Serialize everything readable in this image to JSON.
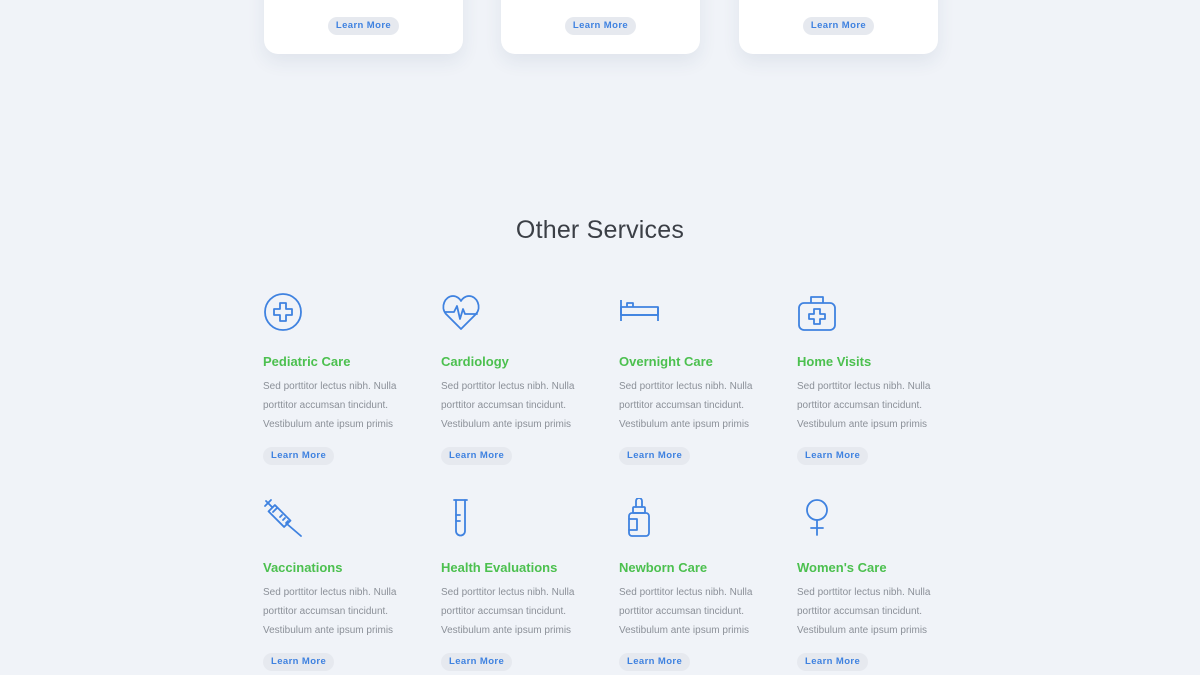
{
  "top_cards": [
    {
      "button": "Learn More"
    },
    {
      "button": "Learn More"
    },
    {
      "button": "Learn More"
    }
  ],
  "section": {
    "title": "Other Services"
  },
  "services": [
    {
      "name": "Pediatric Care",
      "desc": "Sed porttitor lectus nibh. Nulla porttitor accumsan tincidunt. Vestibulum ante ipsum primis",
      "button": "Learn More",
      "icon": "medical-cross-icon"
    },
    {
      "name": "Cardiology",
      "desc": "Sed porttitor lectus nibh. Nulla porttitor accumsan tincidunt. Vestibulum ante ipsum primis",
      "button": "Learn More",
      "icon": "heartbeat-icon"
    },
    {
      "name": "Overnight Care",
      "desc": "Sed porttitor lectus nibh. Nulla porttitor accumsan tincidunt. Vestibulum ante ipsum primis",
      "button": "Learn More",
      "icon": "bed-icon"
    },
    {
      "name": "Home Visits",
      "desc": "Sed porttitor lectus nibh. Nulla porttitor accumsan tincidunt. Vestibulum ante ipsum primis",
      "button": "Learn More",
      "icon": "medical-bag-icon"
    },
    {
      "name": "Vaccinations",
      "desc": "Sed porttitor lectus nibh. Nulla porttitor accumsan tincidunt. Vestibulum ante ipsum primis",
      "button": "Learn More",
      "icon": "syringe-icon"
    },
    {
      "name": "Health Evaluations",
      "desc": "Sed porttitor lectus nibh. Nulla porttitor accumsan tincidunt. Vestibulum ante ipsum primis",
      "button": "Learn More",
      "icon": "test-tube-icon"
    },
    {
      "name": "Newborn Care",
      "desc": "Sed porttitor lectus nibh. Nulla porttitor accumsan tincidunt. Vestibulum ante ipsum primis",
      "button": "Learn More",
      "icon": "baby-bottle-icon"
    },
    {
      "name": "Women's Care",
      "desc": "Sed porttitor lectus nibh. Nulla porttitor accumsan tincidunt. Vestibulum ante ipsum primis",
      "button": "Learn More",
      "icon": "female-symbol-icon"
    }
  ],
  "colors": {
    "accent": "#4cc04f",
    "link": "#3f82e0",
    "icon": "#3f82e0",
    "background": "#f0f3f8"
  }
}
